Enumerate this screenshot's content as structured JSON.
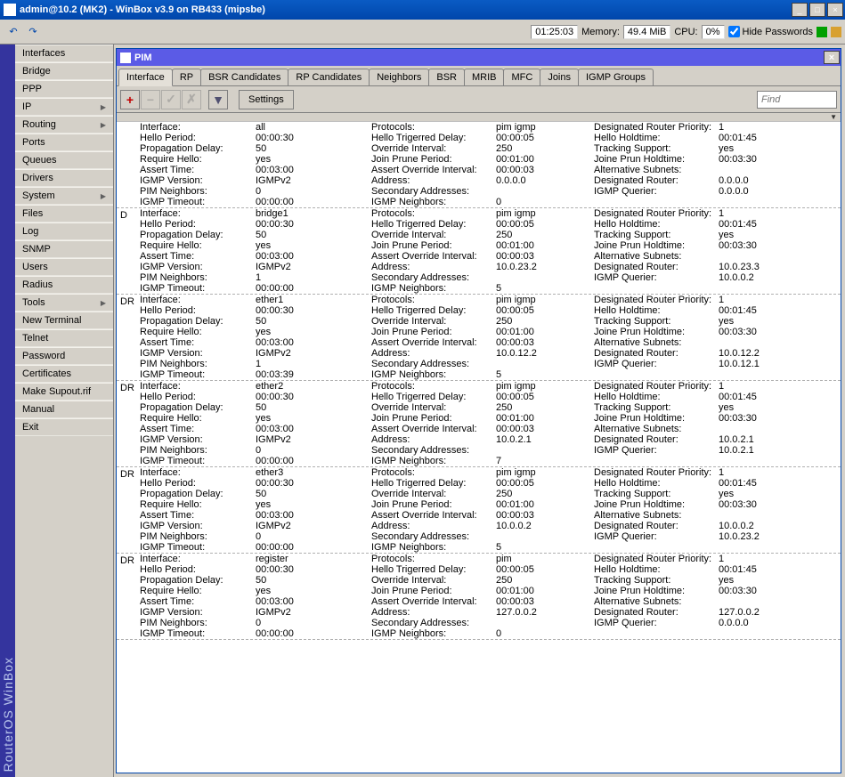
{
  "window": {
    "title": "admin@10.2 (MK2) - WinBox v3.9 on RB433 (mipsbe)"
  },
  "toolbar": {
    "time": "01:25:03",
    "memory_label": "Memory:",
    "memory_value": "49.4 MiB",
    "cpu_label": "CPU:",
    "cpu_value": "0%",
    "hide_pw_label": "Hide Passwords"
  },
  "brand": "RouterOS WinBox",
  "sidebar": [
    {
      "label": "Interfaces",
      "submenu": false
    },
    {
      "label": "Bridge",
      "submenu": false
    },
    {
      "label": "PPP",
      "submenu": false
    },
    {
      "label": "IP",
      "submenu": true
    },
    {
      "label": "Routing",
      "submenu": true
    },
    {
      "label": "Ports",
      "submenu": false
    },
    {
      "label": "Queues",
      "submenu": false
    },
    {
      "label": "Drivers",
      "submenu": false
    },
    {
      "label": "System",
      "submenu": true
    },
    {
      "label": "Files",
      "submenu": false
    },
    {
      "label": "Log",
      "submenu": false
    },
    {
      "label": "SNMP",
      "submenu": false
    },
    {
      "label": "Users",
      "submenu": false
    },
    {
      "label": "Radius",
      "submenu": false
    },
    {
      "label": "Tools",
      "submenu": true
    },
    {
      "label": "New Terminal",
      "submenu": false
    },
    {
      "label": "Telnet",
      "submenu": false
    },
    {
      "label": "Password",
      "submenu": false
    },
    {
      "label": "Certificates",
      "submenu": false
    },
    {
      "label": "Make Supout.rif",
      "submenu": false
    },
    {
      "label": "Manual",
      "submenu": false
    },
    {
      "label": "Exit",
      "submenu": false
    }
  ],
  "pim_window": {
    "title": "PIM",
    "tabs": [
      "Interface",
      "RP",
      "BSR Candidates",
      "RP Candidates",
      "Neighbors",
      "BSR",
      "MRIB",
      "MFC",
      "Joins",
      "IGMP Groups"
    ],
    "active_tab": "Interface",
    "settings_btn": "Settings",
    "find_placeholder": "Find",
    "field_labels": {
      "interface": "Interface:",
      "protocols": "Protocols:",
      "drp": "Designated Router Priority:",
      "hello_period": "Hello Period:",
      "htd": "Hello Trigerred Delay:",
      "hello_hold": "Hello Holdtime:",
      "prop_delay": "Propagation Delay:",
      "ovr_int": "Override Interval:",
      "track": "Tracking Support:",
      "req_hello": "Require Hello:",
      "jpp": "Join Prune Period:",
      "jph": "Joine Prun Holdtime:",
      "assert": "Assert Time:",
      "aoi": "Assert Override Interval:",
      "alt_sub": "Alternative Subnets:",
      "igmp_v": "IGMP Version:",
      "addr": "Address:",
      "dr": "Designated Router:",
      "pim_n": "PIM Neighbors:",
      "sec_addr": "Secondary Addresses:",
      "igmp_q": "IGMP Querier:",
      "igmp_to": "IGMP Timeout:",
      "igmp_n": "IGMP Neighbors:"
    },
    "records": [
      {
        "flag": "",
        "interface": "all",
        "protocols": "pim igmp",
        "drp": "1",
        "hello_period": "00:00:30",
        "htd": "00:00:05",
        "hello_hold": "00:01:45",
        "prop_delay": "50",
        "ovr_int": "250",
        "track": "yes",
        "req_hello": "yes",
        "jpp": "00:01:00",
        "jph": "00:03:30",
        "assert": "00:03:00",
        "aoi": "00:00:03",
        "alt_sub": "",
        "igmp_v": "IGMPv2",
        "addr": "0.0.0.0",
        "dr": "0.0.0.0",
        "pim_n": "0",
        "sec_addr": "",
        "igmp_q": "0.0.0.0",
        "igmp_to": "00:00:00",
        "igmp_n": "0"
      },
      {
        "flag": "D",
        "interface": "bridge1",
        "protocols": "pim igmp",
        "drp": "1",
        "hello_period": "00:00:30",
        "htd": "00:00:05",
        "hello_hold": "00:01:45",
        "prop_delay": "50",
        "ovr_int": "250",
        "track": "yes",
        "req_hello": "yes",
        "jpp": "00:01:00",
        "jph": "00:03:30",
        "assert": "00:03:00",
        "aoi": "00:00:03",
        "alt_sub": "",
        "igmp_v": "IGMPv2",
        "addr": "10.0.23.2",
        "dr": "10.0.23.3",
        "pim_n": "1",
        "sec_addr": "",
        "igmp_q": "10.0.0.2",
        "igmp_to": "00:00:00",
        "igmp_n": "5"
      },
      {
        "flag": "DR",
        "interface": "ether1",
        "protocols": "pim igmp",
        "drp": "1",
        "hello_period": "00:00:30",
        "htd": "00:00:05",
        "hello_hold": "00:01:45",
        "prop_delay": "50",
        "ovr_int": "250",
        "track": "yes",
        "req_hello": "yes",
        "jpp": "00:01:00",
        "jph": "00:03:30",
        "assert": "00:03:00",
        "aoi": "00:00:03",
        "alt_sub": "",
        "igmp_v": "IGMPv2",
        "addr": "10.0.12.2",
        "dr": "10.0.12.2",
        "pim_n": "1",
        "sec_addr": "",
        "igmp_q": "10.0.12.1",
        "igmp_to": "00:03:39",
        "igmp_n": "5"
      },
      {
        "flag": "DR",
        "interface": "ether2",
        "protocols": "pim igmp",
        "drp": "1",
        "hello_period": "00:00:30",
        "htd": "00:00:05",
        "hello_hold": "00:01:45",
        "prop_delay": "50",
        "ovr_int": "250",
        "track": "yes",
        "req_hello": "yes",
        "jpp": "00:01:00",
        "jph": "00:03:30",
        "assert": "00:03:00",
        "aoi": "00:00:03",
        "alt_sub": "",
        "igmp_v": "IGMPv2",
        "addr": "10.0.2.1",
        "dr": "10.0.2.1",
        "pim_n": "0",
        "sec_addr": "",
        "igmp_q": "10.0.2.1",
        "igmp_to": "00:00:00",
        "igmp_n": "7"
      },
      {
        "flag": "DR",
        "interface": "ether3",
        "protocols": "pim igmp",
        "drp": "1",
        "hello_period": "00:00:30",
        "htd": "00:00:05",
        "hello_hold": "00:01:45",
        "prop_delay": "50",
        "ovr_int": "250",
        "track": "yes",
        "req_hello": "yes",
        "jpp": "00:01:00",
        "jph": "00:03:30",
        "assert": "00:03:00",
        "aoi": "00:00:03",
        "alt_sub": "",
        "igmp_v": "IGMPv2",
        "addr": "10.0.0.2",
        "dr": "10.0.0.2",
        "pim_n": "0",
        "sec_addr": "",
        "igmp_q": "10.0.23.2",
        "igmp_to": "00:00:00",
        "igmp_n": "5"
      },
      {
        "flag": "DR",
        "interface": "register",
        "protocols": "pim",
        "drp": "1",
        "hello_period": "00:00:30",
        "htd": "00:00:05",
        "hello_hold": "00:01:45",
        "prop_delay": "50",
        "ovr_int": "250",
        "track": "yes",
        "req_hello": "yes",
        "jpp": "00:01:00",
        "jph": "00:03:30",
        "assert": "00:03:00",
        "aoi": "00:00:03",
        "alt_sub": "",
        "igmp_v": "IGMPv2",
        "addr": "127.0.0.2",
        "dr": "127.0.0.2",
        "pim_n": "0",
        "sec_addr": "",
        "igmp_q": "0.0.0.0",
        "igmp_to": "00:00:00",
        "igmp_n": "0"
      }
    ]
  }
}
